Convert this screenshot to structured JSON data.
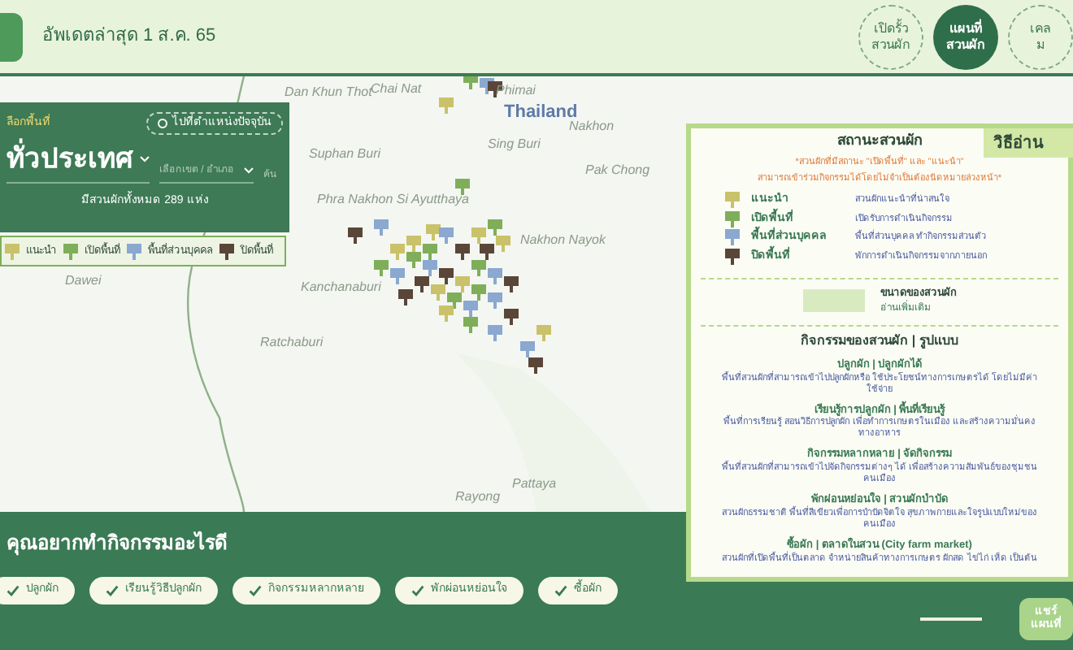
{
  "header": {
    "updated": "อัพเดตล่าสุด 1 ส.ค. 65",
    "nav": [
      {
        "lines": [
          "เปิดรั้ว",
          "สวนผัก"
        ],
        "selected": false
      },
      {
        "lines": [
          "แผนที่",
          "สวนผัก"
        ],
        "selected": true
      },
      {
        "lines": [
          "เคล",
          "ม"
        ],
        "selected": false
      }
    ]
  },
  "map": {
    "labels": [
      "Thailand",
      "Dan Khun Thot",
      "Phimai",
      "Nakhon",
      "Chai Nat",
      "Sing Buri",
      "Pak Chong",
      "Suphan Buri",
      "Phra Nakhon Si Ayutthaya",
      "Nakhon Nayok",
      "Kanchanaburi",
      "Dawei",
      "Ratchaburi",
      "Pattaya",
      "Rayong"
    ]
  },
  "area_panel": {
    "label": "ลือกพื้นที่",
    "locate_button": "ไปที่ตำแหน่งปัจจุบัน",
    "region": "ทั่วประเทศ",
    "district_placeholder": "เลือกเขต / อำเภอ",
    "search_label": "ค้น",
    "count": "มีสวนผักทั้งหมด 289 แห่ง"
  },
  "legend": [
    {
      "label": "แนะนำ",
      "color": "#c9c26a"
    },
    {
      "label": "เปิดพื้นที่",
      "color": "#7fae5a"
    },
    {
      "label": "พื้นที่ส่วนบุคคล",
      "color": "#8aa8d0"
    },
    {
      "label": "ปิดพื้นที่",
      "color": "#5a4638"
    }
  ],
  "guide": {
    "tab": "วิธีอ่าน",
    "status_title": "สถานะสวนผัก",
    "notes": [
      "*สวนผักที่มีสถานะ \"เปิดพื้นที่\" และ \"แนะนำ\"",
      "สามารถเข้าร่วมกิจกรรมได้โดยไม่จำเป็นต้องนัดหมายล่วงหน้า*"
    ],
    "statuses": [
      {
        "label": "แนะนำ",
        "description": "สวนผักแนะนำที่น่าสนใจ",
        "color": "#c9c26a"
      },
      {
        "label": "เปิดพื้นที่",
        "description": "เปิดรับการดำเนินกิจกรรม",
        "color": "#7fae5a"
      },
      {
        "label": "พื้นที่ส่วนบุคคล",
        "description": "พื้นที่ส่วนบุคคล ทำกิจกรรมส่วนตัว",
        "color": "#8aa8d0"
      },
      {
        "label": "ปิดพื้นที่",
        "description": "พักการดำเนินกิจกรรมจากภายนอก",
        "color": "#5a4638"
      }
    ],
    "size_title": "ขนาดของสวนผัก",
    "read_more": "อ่านเพิ่มเติม",
    "activities_title": "กิจกรรมของสวนผัก | รูปแบบ",
    "activities": [
      {
        "title": "ปลูกผัก | ปลูกผักได้",
        "description": "พื้นที่สวนผักที่สามารถเข้าไปปลูกผักหรือ ใช้ประโยชน์ทางการเกษตรได้ โดยไม่มีค่าใช้จ่าย"
      },
      {
        "title": "เรียนรู้การปลูกผัก | พื้นที่เรียนรู้",
        "description": "พื้นที่การเรียนรู้ สอนวิธีการปลูกผัก เพื่อทำการเกษตรในเมือง และสร้างความมั่นคงทางอาหาร"
      },
      {
        "title": "กิจกรรมหลากหลาย | จัดกิจกรรม",
        "description": "พื้นที่สวนผักที่สามารถเข้าไปจัดกิจกรรมต่างๆ ได้ เพื่อสร้างความสัมพันธ์ของชุมชนคนเมือง"
      },
      {
        "title": "พักผ่อนหย่อนใจ | สวนผักบำบัด",
        "description": "สวนผักธรรมชาติ พื้นที่สีเขียวเพื่อการบำบัดจิตใจ สุขภาพกายและใจรูปแบบใหม่ของคนเมือง"
      },
      {
        "title": "ซื้อผัก | ตลาดในสวน (City farm market)",
        "description": "สวนผักที่เปิดพื้นที่เป็นตลาด จำหน่ายสินค้าทางการเกษตร ผักสด ไข่ไก่ เห็ด เป็นต้น"
      }
    ]
  },
  "activity_filter": {
    "question": "คุณอยากทำกิจกรรมอะไรดี",
    "chips": [
      {
        "label": "ปลูกผัก",
        "checked": true
      },
      {
        "label": "เรียนรู้วิธีปลูกผัก",
        "checked": true
      },
      {
        "label": "กิจกรรมหลากหลาย",
        "checked": true
      },
      {
        "label": "พักผ่อนหย่อนใจ",
        "checked": true
      },
      {
        "label": "ซื้อผัก",
        "checked": true
      }
    ]
  },
  "share_button": [
    "แชร์",
    "แผนที่"
  ]
}
